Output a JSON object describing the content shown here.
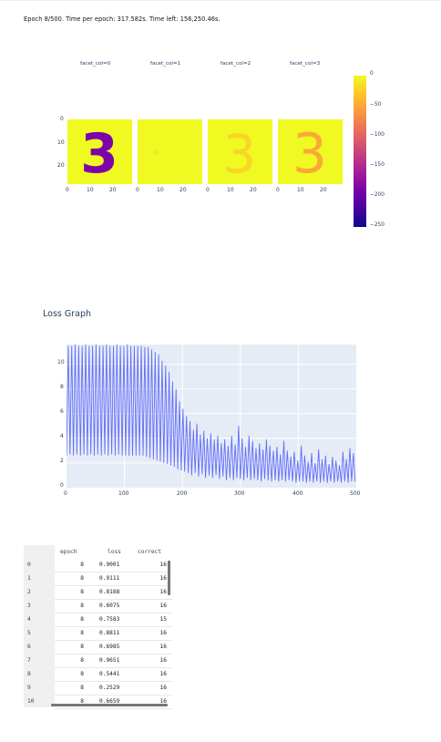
{
  "status": {
    "text": "Epoch 8/500. Time per epoch: 317.582s. Time left: 156,250.46s."
  },
  "facets": [
    {
      "title": "facet_col=0",
      "digit": "3",
      "digit_color": "#7e03a8"
    },
    {
      "title": "facet_col=1",
      "digit": "",
      "digit_color": "#f5e52a"
    },
    {
      "title": "facet_col=2",
      "digit": "3",
      "digit_color": "#fdca26"
    },
    {
      "title": "facet_col=3",
      "digit": "3",
      "digit_color": "#fba238"
    }
  ],
  "facet_axes": {
    "y_ticks": [
      "0",
      "10",
      "20"
    ],
    "x_ticks": [
      "0",
      "10",
      "20"
    ]
  },
  "colorbar": {
    "colorscale": "plasma",
    "ticks": [
      "0",
      "−50",
      "−100",
      "−150",
      "−200",
      "−250"
    ]
  },
  "loss_graph": {
    "title": "Loss Graph",
    "y_ticks": [
      "0",
      "2",
      "4",
      "6",
      "8",
      "10"
    ],
    "x_ticks": [
      "0",
      "100",
      "200",
      "300",
      "400",
      "500"
    ]
  },
  "chart_data": {
    "type": "line",
    "title": "Loss Graph",
    "xlabel": "",
    "ylabel": "",
    "xlim": [
      0,
      500
    ],
    "ylim": [
      0,
      11.6
    ],
    "series": [
      {
        "line_color": "#636efa",
        "points": [
          [
            0,
            2.6
          ],
          [
            3,
            11.5
          ],
          [
            6,
            2.7
          ],
          [
            9,
            11.5
          ],
          [
            12,
            2.6
          ],
          [
            15,
            11.6
          ],
          [
            18,
            2.7
          ],
          [
            21,
            11.5
          ],
          [
            24,
            2.6
          ],
          [
            27,
            11.5
          ],
          [
            30,
            2.7
          ],
          [
            33,
            11.6
          ],
          [
            36,
            2.6
          ],
          [
            39,
            11.5
          ],
          [
            42,
            2.7
          ],
          [
            45,
            11.5
          ],
          [
            48,
            2.6
          ],
          [
            51,
            11.6
          ],
          [
            54,
            2.7
          ],
          [
            57,
            11.5
          ],
          [
            60,
            2.6
          ],
          [
            63,
            11.5
          ],
          [
            66,
            2.7
          ],
          [
            69,
            11.6
          ],
          [
            72,
            2.6
          ],
          [
            75,
            11.5
          ],
          [
            78,
            2.7
          ],
          [
            81,
            11.5
          ],
          [
            84,
            2.6
          ],
          [
            87,
            11.6
          ],
          [
            90,
            2.7
          ],
          [
            93,
            11.5
          ],
          [
            96,
            2.6
          ],
          [
            99,
            11.5
          ],
          [
            102,
            2.6
          ],
          [
            105,
            11.6
          ],
          [
            108,
            2.6
          ],
          [
            111,
            11.5
          ],
          [
            114,
            2.6
          ],
          [
            117,
            11.5
          ],
          [
            120,
            2.6
          ],
          [
            123,
            11.5
          ],
          [
            126,
            2.6
          ],
          [
            129,
            11.5
          ],
          [
            132,
            2.6
          ],
          [
            135,
            11.4
          ],
          [
            138,
            2.5
          ],
          [
            141,
            11.4
          ],
          [
            144,
            2.4
          ],
          [
            147,
            11.2
          ],
          [
            150,
            2.3
          ],
          [
            153,
            11.0
          ],
          [
            156,
            2.2
          ],
          [
            159,
            10.8
          ],
          [
            162,
            2.1
          ],
          [
            165,
            10.3
          ],
          [
            168,
            2.0
          ],
          [
            171,
            9.9
          ],
          [
            174,
            1.9
          ],
          [
            177,
            9.4
          ],
          [
            180,
            1.8
          ],
          [
            183,
            8.6
          ],
          [
            186,
            1.7
          ],
          [
            189,
            8.0
          ],
          [
            192,
            1.5
          ],
          [
            195,
            7.0
          ],
          [
            198,
            1.4
          ],
          [
            201,
            6.4
          ],
          [
            204,
            1.3
          ],
          [
            207,
            5.8
          ],
          [
            210,
            1.2
          ],
          [
            213,
            5.4
          ],
          [
            216,
            1.0
          ],
          [
            219,
            4.7
          ],
          [
            222,
            1.2
          ],
          [
            225,
            5.2
          ],
          [
            228,
            0.9
          ],
          [
            231,
            4.3
          ],
          [
            234,
            1.1
          ],
          [
            237,
            4.6
          ],
          [
            240,
            0.8
          ],
          [
            243,
            4.0
          ],
          [
            246,
            1.0
          ],
          [
            249,
            4.4
          ],
          [
            252,
            0.8
          ],
          [
            255,
            3.9
          ],
          [
            258,
            1.0
          ],
          [
            261,
            4.2
          ],
          [
            264,
            0.7
          ],
          [
            267,
            3.6
          ],
          [
            270,
            0.9
          ],
          [
            273,
            3.9
          ],
          [
            276,
            0.6
          ],
          [
            279,
            3.4
          ],
          [
            282,
            0.8
          ],
          [
            285,
            4.2
          ],
          [
            288,
            0.6
          ],
          [
            291,
            3.5
          ],
          [
            294,
            0.8
          ],
          [
            297,
            5.0
          ],
          [
            300,
            0.7
          ],
          [
            303,
            4.0
          ],
          [
            306,
            0.6
          ],
          [
            309,
            3.3
          ],
          [
            312,
            0.8
          ],
          [
            315,
            4.2
          ],
          [
            318,
            0.6
          ],
          [
            321,
            3.8
          ],
          [
            324,
            0.7
          ],
          [
            327,
            3.2
          ],
          [
            330,
            0.6
          ],
          [
            333,
            3.6
          ],
          [
            336,
            0.5
          ],
          [
            339,
            3.1
          ],
          [
            342,
            0.7
          ],
          [
            345,
            3.9
          ],
          [
            348,
            0.6
          ],
          [
            351,
            3.4
          ],
          [
            354,
            0.5
          ],
          [
            357,
            3.0
          ],
          [
            360,
            0.6
          ],
          [
            363,
            3.3
          ],
          [
            366,
            0.5
          ],
          [
            369,
            2.7
          ],
          [
            372,
            0.6
          ],
          [
            375,
            3.8
          ],
          [
            378,
            0.5
          ],
          [
            381,
            3.0
          ],
          [
            384,
            0.6
          ],
          [
            387,
            2.5
          ],
          [
            390,
            0.5
          ],
          [
            393,
            2.9
          ],
          [
            396,
            0.4
          ],
          [
            399,
            2.2
          ],
          [
            402,
            0.5
          ],
          [
            405,
            3.4
          ],
          [
            408,
            0.5
          ],
          [
            411,
            2.6
          ],
          [
            414,
            0.4
          ],
          [
            417,
            2.1
          ],
          [
            420,
            0.5
          ],
          [
            423,
            2.8
          ],
          [
            426,
            0.4
          ],
          [
            429,
            2.0
          ],
          [
            432,
            0.5
          ],
          [
            435,
            3.1
          ],
          [
            438,
            0.4
          ],
          [
            441,
            2.3
          ],
          [
            444,
            0.5
          ],
          [
            447,
            2.6
          ],
          [
            450,
            0.4
          ],
          [
            453,
            1.9
          ],
          [
            456,
            0.5
          ],
          [
            459,
            2.5
          ],
          [
            462,
            0.4
          ],
          [
            465,
            2.2
          ],
          [
            468,
            0.5
          ],
          [
            471,
            1.8
          ],
          [
            474,
            0.4
          ],
          [
            477,
            2.9
          ],
          [
            480,
            0.5
          ],
          [
            483,
            2.3
          ],
          [
            486,
            0.4
          ],
          [
            489,
            3.2
          ],
          [
            492,
            0.5
          ],
          [
            495,
            2.8
          ],
          [
            498,
            0.5
          ]
        ]
      }
    ]
  },
  "table": {
    "columns": [
      "epoch",
      "loss",
      "correct"
    ],
    "rows": [
      {
        "index": "0",
        "epoch": "8",
        "loss": "0.9001",
        "correct": "16"
      },
      {
        "index": "1",
        "epoch": "8",
        "loss": "0.9111",
        "correct": "16"
      },
      {
        "index": "2",
        "epoch": "8",
        "loss": "0.8188",
        "correct": "16"
      },
      {
        "index": "3",
        "epoch": "8",
        "loss": "0.6075",
        "correct": "16"
      },
      {
        "index": "4",
        "epoch": "8",
        "loss": "0.7583",
        "correct": "15"
      },
      {
        "index": "5",
        "epoch": "8",
        "loss": "0.8811",
        "correct": "16"
      },
      {
        "index": "6",
        "epoch": "8",
        "loss": "0.6985",
        "correct": "16"
      },
      {
        "index": "7",
        "epoch": "8",
        "loss": "0.9651",
        "correct": "16"
      },
      {
        "index": "8",
        "epoch": "8",
        "loss": "0.5441",
        "correct": "16"
      },
      {
        "index": "9",
        "epoch": "8",
        "loss": "0.2529",
        "correct": "16"
      },
      {
        "index": "10",
        "epoch": "8",
        "loss": "0.6659",
        "correct": "16"
      }
    ]
  }
}
